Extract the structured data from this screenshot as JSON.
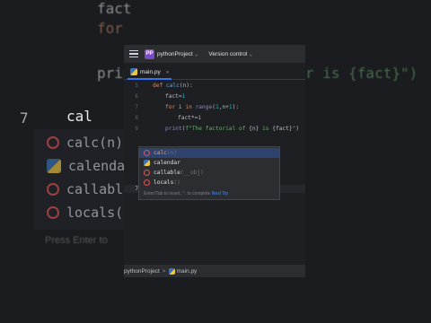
{
  "background": {
    "lines": [
      "fact",
      "for",
      "prin",
      "r is {fact}\")",
      "7",
      "cal"
    ],
    "popup_items": [
      "calc(n)",
      "calendar",
      "callable(",
      "locals("
    ],
    "bottom_hint": "Press Enter to"
  },
  "titlebar": {
    "project_badge": "PP",
    "project_name": "pythonProject",
    "vcs_label": "Version control"
  },
  "tab": {
    "label": "main.py"
  },
  "editor": {
    "line_numbers": [
      "5",
      "6",
      "7",
      "8",
      "9",
      "10",
      "",
      "",
      "7"
    ],
    "current_line_number": "7",
    "typed_text": "cal"
  },
  "completion": {
    "items": [
      {
        "label": "calc",
        "tail": "(n)",
        "icon": "error-icon"
      },
      {
        "label": "calendar",
        "tail": "",
        "icon": "python-icon"
      },
      {
        "label": "callable",
        "tail": "(__obj)",
        "icon": "error-icon"
      },
      {
        "label": "locals",
        "tail": "()",
        "icon": "error-icon"
      }
    ],
    "hint": "Enter/Tab to insert, ^. to complete",
    "hint_tip": "Next Tip"
  },
  "statusbar": {
    "project": "pythonProject",
    "separator": ">",
    "file": "main.py"
  }
}
